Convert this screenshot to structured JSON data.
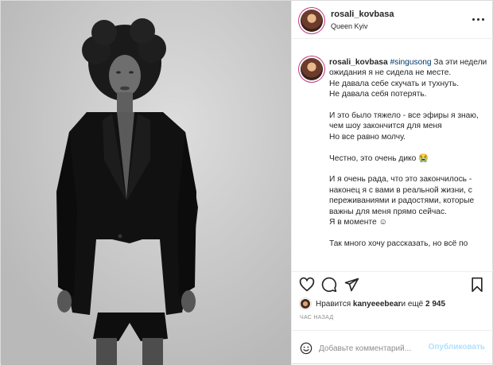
{
  "post": {
    "username": "rosali_kovbasa",
    "location": "Queen Kyiv",
    "caption": {
      "username": "rosali_kovbasa",
      "hashtag": "#singusong",
      "first_text": " За эти недели ожидания я не сидела не месте.",
      "lines": [
        "Не давала себе скучать и тухнуть.",
        "Не давала себя потерять.",
        "",
        "И это было тяжело - все эфиры я знаю, чем шоу закончится для меня",
        "Но все равно молчу.",
        "",
        "Честно, это очень дико 😭",
        "",
        "И я очень рада, что это закончилось - наконец я с вами в реальной жизни, с переживаниями и радостями, которые важны для меня прямо сейчас.",
        "Я в моменте ☺",
        "",
        "Так много хочу рассказать, но всё по"
      ]
    },
    "likes": {
      "prefix": "Нравится ",
      "user": "kanyeeebear",
      "suffix": " и ещё ",
      "count": "2 945"
    },
    "timestamp": "час назад",
    "comment": {
      "placeholder": "Добавьте комментарий...",
      "publish_label": "Опубликовать"
    }
  },
  "icons": {
    "more": "more-options-icon",
    "like": "heart-icon",
    "comment": "comment-icon",
    "share": "paper-plane-icon",
    "save": "bookmark-icon",
    "emoji": "smile-icon"
  },
  "colors": {
    "link": "#00376b",
    "publish_disabled": "#b2dffc",
    "muted": "#8e8e8e",
    "border": "#dbdbdb"
  }
}
